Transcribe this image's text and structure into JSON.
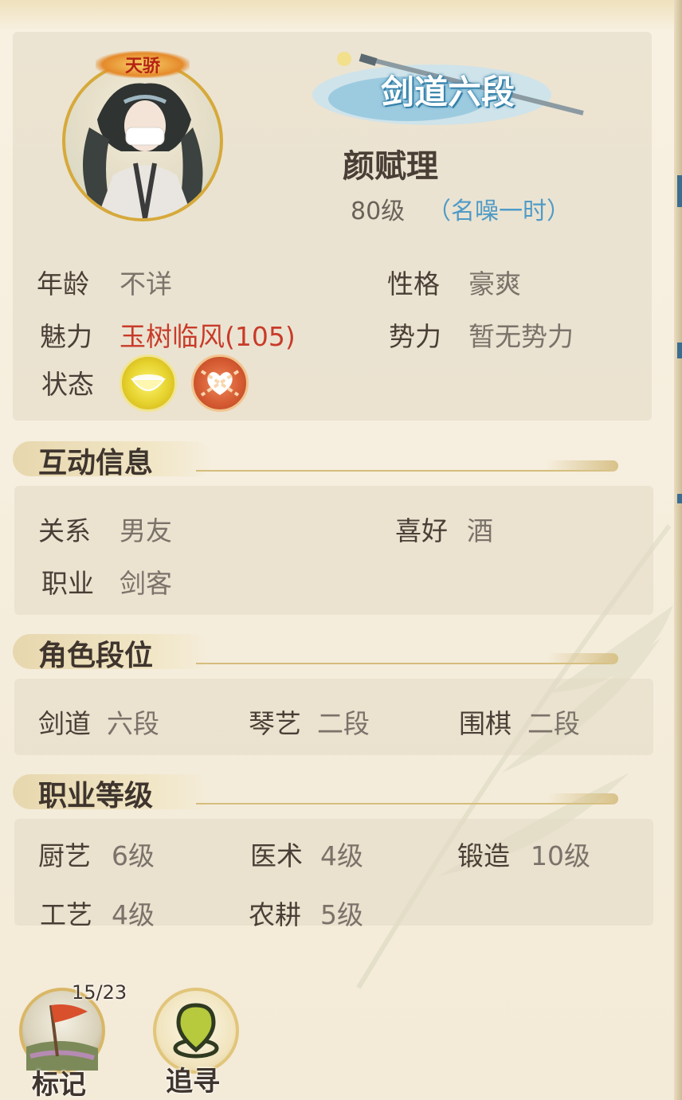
{
  "profile": {
    "title_badge": "天骄",
    "rank_banner": "剑道六段",
    "name": "颜赋理",
    "level": "80级",
    "fame": "（名噪一时）",
    "attributes": {
      "age_label": "年龄",
      "age_value": "不详",
      "personality_label": "性格",
      "personality_value": "豪爽",
      "charm_label": "魅力",
      "charm_value": "玉树临风(105)",
      "faction_label": "势力",
      "faction_value": "暂无势力",
      "status_label": "状态"
    },
    "status_icons": [
      "bowl-icon",
      "chain-heart-icon"
    ]
  },
  "interaction": {
    "title": "互动信息",
    "relation_label": "关系",
    "relation_value": "男友",
    "hobby_label": "喜好",
    "hobby_value": "酒",
    "job_label": "职业",
    "job_value": "剑客"
  },
  "ranks": {
    "title": "角色段位",
    "items": [
      {
        "label": "剑道",
        "value": "六段"
      },
      {
        "label": "琴艺",
        "value": "二段"
      },
      {
        "label": "围棋",
        "value": "二段"
      }
    ]
  },
  "skills": {
    "title": "职业等级",
    "items": [
      {
        "label": "厨艺",
        "value": "6级"
      },
      {
        "label": "医术",
        "value": "4级"
      },
      {
        "label": "锻造",
        "value": "10级"
      },
      {
        "label": "工艺",
        "value": "4级"
      },
      {
        "label": "农耕",
        "value": "5级"
      }
    ]
  },
  "bottom": {
    "mark_count": "15/23",
    "mark_label": "标记",
    "seek_label": "追寻"
  },
  "colors": {
    "accent_red": "#c83b2a",
    "fame_blue": "#4f9bc7",
    "gold": "#d6a93a"
  }
}
